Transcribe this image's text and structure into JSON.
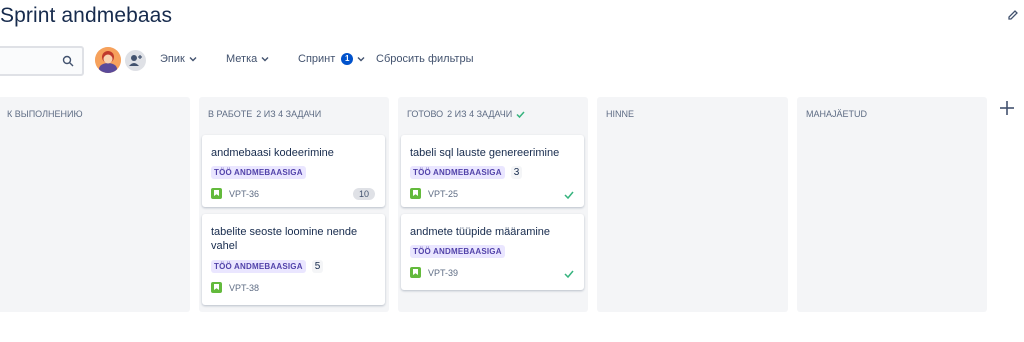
{
  "page": {
    "title": "Sprint andmebaas"
  },
  "toolbar": {
    "search_placeholder": "",
    "filters": {
      "epic": "Эпик",
      "label": "Метка",
      "sprint": "Спринт",
      "sprint_count": "1"
    },
    "reset": "Сбросить фильтры"
  },
  "columns": [
    {
      "title": "К ВЫПОЛНЕНИЮ",
      "count": ""
    },
    {
      "title": "В РАБОТЕ",
      "count": "2 ИЗ 4 ЗАДАЧИ"
    },
    {
      "title": "ГОТОВО",
      "count": "2 ИЗ 4 ЗАДАЧИ"
    },
    {
      "title": "HINNE",
      "count": ""
    },
    {
      "title": "MAHAJÄETUD",
      "count": ""
    }
  ],
  "cards": [
    {
      "title": "andmebaasi kodeerimine",
      "epic": "TÖÖ ANDMEBAASIGA",
      "key": "VPT-36",
      "estimate": "10"
    },
    {
      "title": "tabelite seoste loomine nende vahel",
      "epic": "TÖÖ ANDMEBAASIGA",
      "key": "VPT-38",
      "estimate": "5"
    },
    {
      "title": "tabeli sql lauste genereerimine",
      "epic": "TÖÖ ANDMEBAASIGA",
      "key": "VPT-25",
      "estimate": "3"
    },
    {
      "title": "andmete tüüpide määramine",
      "epic": "TÖÖ ANDMEBAASIGA",
      "key": "VPT-39",
      "estimate": ""
    }
  ],
  "colors": {
    "accent": "#0052cc",
    "epic_text": "#5243aa",
    "epic_bg": "#eae6ff",
    "story": "#63ba3c",
    "done": "#36b37e",
    "column_bg": "#f4f5f7"
  },
  "icons": {
    "search": "search-icon",
    "edit": "edit-icon",
    "add_user": "add-user-icon",
    "add_column": "plus-icon",
    "done": "check-icon",
    "story": "story-icon"
  }
}
